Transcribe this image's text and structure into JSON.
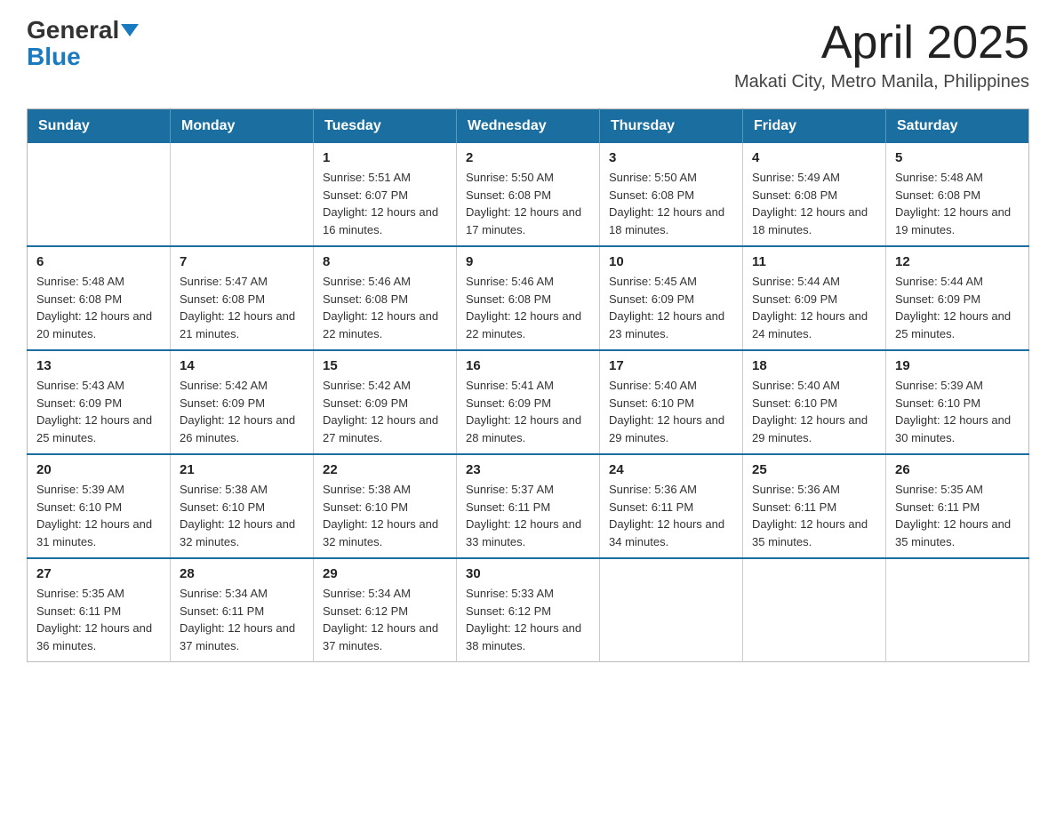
{
  "header": {
    "logo_general": "General",
    "logo_blue": "Blue",
    "month_title": "April 2025",
    "location": "Makati City, Metro Manila, Philippines"
  },
  "weekdays": [
    "Sunday",
    "Monday",
    "Tuesday",
    "Wednesday",
    "Thursday",
    "Friday",
    "Saturday"
  ],
  "weeks": [
    [
      {
        "day": "",
        "sunrise": "",
        "sunset": "",
        "daylight": ""
      },
      {
        "day": "",
        "sunrise": "",
        "sunset": "",
        "daylight": ""
      },
      {
        "day": "1",
        "sunrise": "Sunrise: 5:51 AM",
        "sunset": "Sunset: 6:07 PM",
        "daylight": "Daylight: 12 hours and 16 minutes."
      },
      {
        "day": "2",
        "sunrise": "Sunrise: 5:50 AM",
        "sunset": "Sunset: 6:08 PM",
        "daylight": "Daylight: 12 hours and 17 minutes."
      },
      {
        "day": "3",
        "sunrise": "Sunrise: 5:50 AM",
        "sunset": "Sunset: 6:08 PM",
        "daylight": "Daylight: 12 hours and 18 minutes."
      },
      {
        "day": "4",
        "sunrise": "Sunrise: 5:49 AM",
        "sunset": "Sunset: 6:08 PM",
        "daylight": "Daylight: 12 hours and 18 minutes."
      },
      {
        "day": "5",
        "sunrise": "Sunrise: 5:48 AM",
        "sunset": "Sunset: 6:08 PM",
        "daylight": "Daylight: 12 hours and 19 minutes."
      }
    ],
    [
      {
        "day": "6",
        "sunrise": "Sunrise: 5:48 AM",
        "sunset": "Sunset: 6:08 PM",
        "daylight": "Daylight: 12 hours and 20 minutes."
      },
      {
        "day": "7",
        "sunrise": "Sunrise: 5:47 AM",
        "sunset": "Sunset: 6:08 PM",
        "daylight": "Daylight: 12 hours and 21 minutes."
      },
      {
        "day": "8",
        "sunrise": "Sunrise: 5:46 AM",
        "sunset": "Sunset: 6:08 PM",
        "daylight": "Daylight: 12 hours and 22 minutes."
      },
      {
        "day": "9",
        "sunrise": "Sunrise: 5:46 AM",
        "sunset": "Sunset: 6:08 PM",
        "daylight": "Daylight: 12 hours and 22 minutes."
      },
      {
        "day": "10",
        "sunrise": "Sunrise: 5:45 AM",
        "sunset": "Sunset: 6:09 PM",
        "daylight": "Daylight: 12 hours and 23 minutes."
      },
      {
        "day": "11",
        "sunrise": "Sunrise: 5:44 AM",
        "sunset": "Sunset: 6:09 PM",
        "daylight": "Daylight: 12 hours and 24 minutes."
      },
      {
        "day": "12",
        "sunrise": "Sunrise: 5:44 AM",
        "sunset": "Sunset: 6:09 PM",
        "daylight": "Daylight: 12 hours and 25 minutes."
      }
    ],
    [
      {
        "day": "13",
        "sunrise": "Sunrise: 5:43 AM",
        "sunset": "Sunset: 6:09 PM",
        "daylight": "Daylight: 12 hours and 25 minutes."
      },
      {
        "day": "14",
        "sunrise": "Sunrise: 5:42 AM",
        "sunset": "Sunset: 6:09 PM",
        "daylight": "Daylight: 12 hours and 26 minutes."
      },
      {
        "day": "15",
        "sunrise": "Sunrise: 5:42 AM",
        "sunset": "Sunset: 6:09 PM",
        "daylight": "Daylight: 12 hours and 27 minutes."
      },
      {
        "day": "16",
        "sunrise": "Sunrise: 5:41 AM",
        "sunset": "Sunset: 6:09 PM",
        "daylight": "Daylight: 12 hours and 28 minutes."
      },
      {
        "day": "17",
        "sunrise": "Sunrise: 5:40 AM",
        "sunset": "Sunset: 6:10 PM",
        "daylight": "Daylight: 12 hours and 29 minutes."
      },
      {
        "day": "18",
        "sunrise": "Sunrise: 5:40 AM",
        "sunset": "Sunset: 6:10 PM",
        "daylight": "Daylight: 12 hours and 29 minutes."
      },
      {
        "day": "19",
        "sunrise": "Sunrise: 5:39 AM",
        "sunset": "Sunset: 6:10 PM",
        "daylight": "Daylight: 12 hours and 30 minutes."
      }
    ],
    [
      {
        "day": "20",
        "sunrise": "Sunrise: 5:39 AM",
        "sunset": "Sunset: 6:10 PM",
        "daylight": "Daylight: 12 hours and 31 minutes."
      },
      {
        "day": "21",
        "sunrise": "Sunrise: 5:38 AM",
        "sunset": "Sunset: 6:10 PM",
        "daylight": "Daylight: 12 hours and 32 minutes."
      },
      {
        "day": "22",
        "sunrise": "Sunrise: 5:38 AM",
        "sunset": "Sunset: 6:10 PM",
        "daylight": "Daylight: 12 hours and 32 minutes."
      },
      {
        "day": "23",
        "sunrise": "Sunrise: 5:37 AM",
        "sunset": "Sunset: 6:11 PM",
        "daylight": "Daylight: 12 hours and 33 minutes."
      },
      {
        "day": "24",
        "sunrise": "Sunrise: 5:36 AM",
        "sunset": "Sunset: 6:11 PM",
        "daylight": "Daylight: 12 hours and 34 minutes."
      },
      {
        "day": "25",
        "sunrise": "Sunrise: 5:36 AM",
        "sunset": "Sunset: 6:11 PM",
        "daylight": "Daylight: 12 hours and 35 minutes."
      },
      {
        "day": "26",
        "sunrise": "Sunrise: 5:35 AM",
        "sunset": "Sunset: 6:11 PM",
        "daylight": "Daylight: 12 hours and 35 minutes."
      }
    ],
    [
      {
        "day": "27",
        "sunrise": "Sunrise: 5:35 AM",
        "sunset": "Sunset: 6:11 PM",
        "daylight": "Daylight: 12 hours and 36 minutes."
      },
      {
        "day": "28",
        "sunrise": "Sunrise: 5:34 AM",
        "sunset": "Sunset: 6:11 PM",
        "daylight": "Daylight: 12 hours and 37 minutes."
      },
      {
        "day": "29",
        "sunrise": "Sunrise: 5:34 AM",
        "sunset": "Sunset: 6:12 PM",
        "daylight": "Daylight: 12 hours and 37 minutes."
      },
      {
        "day": "30",
        "sunrise": "Sunrise: 5:33 AM",
        "sunset": "Sunset: 6:12 PM",
        "daylight": "Daylight: 12 hours and 38 minutes."
      },
      {
        "day": "",
        "sunrise": "",
        "sunset": "",
        "daylight": ""
      },
      {
        "day": "",
        "sunrise": "",
        "sunset": "",
        "daylight": ""
      },
      {
        "day": "",
        "sunrise": "",
        "sunset": "",
        "daylight": ""
      }
    ]
  ]
}
